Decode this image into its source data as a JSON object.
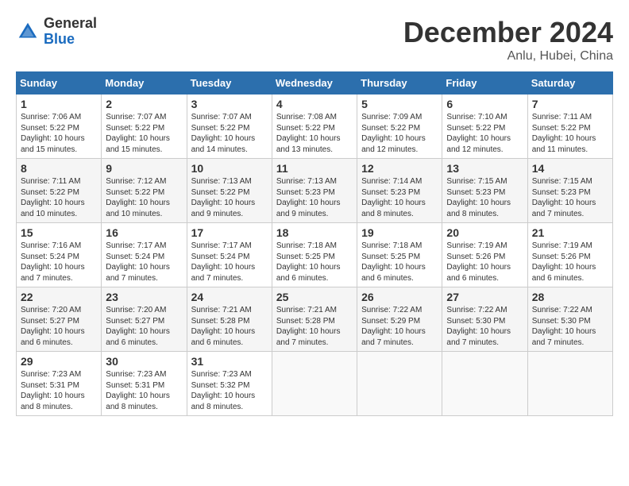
{
  "logo": {
    "general": "General",
    "blue": "Blue"
  },
  "title": "December 2024",
  "location": "Anlu, Hubei, China",
  "days_of_week": [
    "Sunday",
    "Monday",
    "Tuesday",
    "Wednesday",
    "Thursday",
    "Friday",
    "Saturday"
  ],
  "weeks": [
    [
      {
        "day": "1",
        "sunrise": "Sunrise: 7:06 AM",
        "sunset": "Sunset: 5:22 PM",
        "daylight": "Daylight: 10 hours and 15 minutes."
      },
      {
        "day": "2",
        "sunrise": "Sunrise: 7:07 AM",
        "sunset": "Sunset: 5:22 PM",
        "daylight": "Daylight: 10 hours and 15 minutes."
      },
      {
        "day": "3",
        "sunrise": "Sunrise: 7:07 AM",
        "sunset": "Sunset: 5:22 PM",
        "daylight": "Daylight: 10 hours and 14 minutes."
      },
      {
        "day": "4",
        "sunrise": "Sunrise: 7:08 AM",
        "sunset": "Sunset: 5:22 PM",
        "daylight": "Daylight: 10 hours and 13 minutes."
      },
      {
        "day": "5",
        "sunrise": "Sunrise: 7:09 AM",
        "sunset": "Sunset: 5:22 PM",
        "daylight": "Daylight: 10 hours and 12 minutes."
      },
      {
        "day": "6",
        "sunrise": "Sunrise: 7:10 AM",
        "sunset": "Sunset: 5:22 PM",
        "daylight": "Daylight: 10 hours and 12 minutes."
      },
      {
        "day": "7",
        "sunrise": "Sunrise: 7:11 AM",
        "sunset": "Sunset: 5:22 PM",
        "daylight": "Daylight: 10 hours and 11 minutes."
      }
    ],
    [
      {
        "day": "8",
        "sunrise": "Sunrise: 7:11 AM",
        "sunset": "Sunset: 5:22 PM",
        "daylight": "Daylight: 10 hours and 10 minutes."
      },
      {
        "day": "9",
        "sunrise": "Sunrise: 7:12 AM",
        "sunset": "Sunset: 5:22 PM",
        "daylight": "Daylight: 10 hours and 10 minutes."
      },
      {
        "day": "10",
        "sunrise": "Sunrise: 7:13 AM",
        "sunset": "Sunset: 5:22 PM",
        "daylight": "Daylight: 10 hours and 9 minutes."
      },
      {
        "day": "11",
        "sunrise": "Sunrise: 7:13 AM",
        "sunset": "Sunset: 5:23 PM",
        "daylight": "Daylight: 10 hours and 9 minutes."
      },
      {
        "day": "12",
        "sunrise": "Sunrise: 7:14 AM",
        "sunset": "Sunset: 5:23 PM",
        "daylight": "Daylight: 10 hours and 8 minutes."
      },
      {
        "day": "13",
        "sunrise": "Sunrise: 7:15 AM",
        "sunset": "Sunset: 5:23 PM",
        "daylight": "Daylight: 10 hours and 8 minutes."
      },
      {
        "day": "14",
        "sunrise": "Sunrise: 7:15 AM",
        "sunset": "Sunset: 5:23 PM",
        "daylight": "Daylight: 10 hours and 7 minutes."
      }
    ],
    [
      {
        "day": "15",
        "sunrise": "Sunrise: 7:16 AM",
        "sunset": "Sunset: 5:24 PM",
        "daylight": "Daylight: 10 hours and 7 minutes."
      },
      {
        "day": "16",
        "sunrise": "Sunrise: 7:17 AM",
        "sunset": "Sunset: 5:24 PM",
        "daylight": "Daylight: 10 hours and 7 minutes."
      },
      {
        "day": "17",
        "sunrise": "Sunrise: 7:17 AM",
        "sunset": "Sunset: 5:24 PM",
        "daylight": "Daylight: 10 hours and 7 minutes."
      },
      {
        "day": "18",
        "sunrise": "Sunrise: 7:18 AM",
        "sunset": "Sunset: 5:25 PM",
        "daylight": "Daylight: 10 hours and 6 minutes."
      },
      {
        "day": "19",
        "sunrise": "Sunrise: 7:18 AM",
        "sunset": "Sunset: 5:25 PM",
        "daylight": "Daylight: 10 hours and 6 minutes."
      },
      {
        "day": "20",
        "sunrise": "Sunrise: 7:19 AM",
        "sunset": "Sunset: 5:26 PM",
        "daylight": "Daylight: 10 hours and 6 minutes."
      },
      {
        "day": "21",
        "sunrise": "Sunrise: 7:19 AM",
        "sunset": "Sunset: 5:26 PM",
        "daylight": "Daylight: 10 hours and 6 minutes."
      }
    ],
    [
      {
        "day": "22",
        "sunrise": "Sunrise: 7:20 AM",
        "sunset": "Sunset: 5:27 PM",
        "daylight": "Daylight: 10 hours and 6 minutes."
      },
      {
        "day": "23",
        "sunrise": "Sunrise: 7:20 AM",
        "sunset": "Sunset: 5:27 PM",
        "daylight": "Daylight: 10 hours and 6 minutes."
      },
      {
        "day": "24",
        "sunrise": "Sunrise: 7:21 AM",
        "sunset": "Sunset: 5:28 PM",
        "daylight": "Daylight: 10 hours and 6 minutes."
      },
      {
        "day": "25",
        "sunrise": "Sunrise: 7:21 AM",
        "sunset": "Sunset: 5:28 PM",
        "daylight": "Daylight: 10 hours and 7 minutes."
      },
      {
        "day": "26",
        "sunrise": "Sunrise: 7:22 AM",
        "sunset": "Sunset: 5:29 PM",
        "daylight": "Daylight: 10 hours and 7 minutes."
      },
      {
        "day": "27",
        "sunrise": "Sunrise: 7:22 AM",
        "sunset": "Sunset: 5:30 PM",
        "daylight": "Daylight: 10 hours and 7 minutes."
      },
      {
        "day": "28",
        "sunrise": "Sunrise: 7:22 AM",
        "sunset": "Sunset: 5:30 PM",
        "daylight": "Daylight: 10 hours and 7 minutes."
      }
    ],
    [
      {
        "day": "29",
        "sunrise": "Sunrise: 7:23 AM",
        "sunset": "Sunset: 5:31 PM",
        "daylight": "Daylight: 10 hours and 8 minutes."
      },
      {
        "day": "30",
        "sunrise": "Sunrise: 7:23 AM",
        "sunset": "Sunset: 5:31 PM",
        "daylight": "Daylight: 10 hours and 8 minutes."
      },
      {
        "day": "31",
        "sunrise": "Sunrise: 7:23 AM",
        "sunset": "Sunset: 5:32 PM",
        "daylight": "Daylight: 10 hours and 8 minutes."
      },
      null,
      null,
      null,
      null
    ]
  ]
}
